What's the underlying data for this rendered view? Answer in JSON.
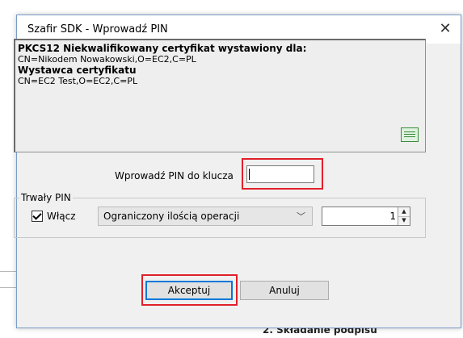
{
  "background": {
    "section_heading": "2. Składanie podpisu"
  },
  "dialog": {
    "title": "Szafir SDK - Wprowadź PIN",
    "close_glyph": "✕"
  },
  "info": {
    "subject_heading": "PKCS12 Niekwalifikowany certyfikat wystawiony dla:",
    "subject_dn": "CN=Nikodem Nowakowski,O=EC2,C=PL",
    "issuer_heading": "Wystawca certyfikatu",
    "issuer_dn": "CN=EC2 Test,O=EC2,C=PL",
    "icon": "certificate-icon"
  },
  "pin": {
    "label": "Wprowadź PIN do klucza",
    "value": ""
  },
  "persistent_pin": {
    "legend": "Trwały PIN",
    "checkbox_label": "Włącz",
    "checked": true,
    "mode_selected": "Ograniczony ilością operacji",
    "count_value": "1"
  },
  "buttons": {
    "accept": "Akceptuj",
    "cancel": "Anuluj"
  },
  "highlight_color": "#e0202a"
}
